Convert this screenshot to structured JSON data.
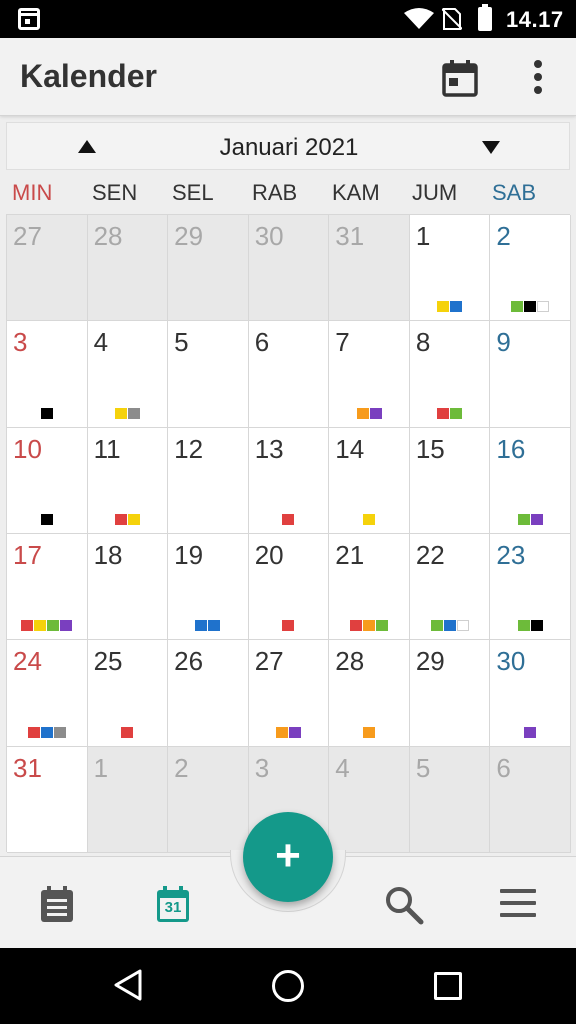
{
  "status_bar": {
    "time": "14.17",
    "icons": [
      "calendar-notification-icon",
      "wifi-icon",
      "no-sim-icon",
      "battery-icon"
    ]
  },
  "app_bar": {
    "title": "Kalender",
    "actions": [
      "today-calendar-icon",
      "overflow-menu-icon"
    ]
  },
  "month_nav": {
    "title": "Januari 2021",
    "prev_icon": "triangle-up-icon",
    "next_icon": "triangle-down-icon"
  },
  "weekdays": [
    "MIN",
    "SEN",
    "SEL",
    "RAB",
    "KAM",
    "JUM",
    "SAB"
  ],
  "colors": {
    "red": "#e0403f",
    "yellow": "#f5d20b",
    "blue": "#1f72cc",
    "gray": "#8c8c8c",
    "green": "#6dbb3a",
    "black": "#000000",
    "white": "#ffffff",
    "orange": "#f79b1c",
    "purple": "#7a3fbf",
    "accent": "#14998a",
    "sunday": "#c94a4a",
    "saturday": "#2f6f96"
  },
  "weeks": [
    [
      {
        "day": "27",
        "other": true,
        "events": []
      },
      {
        "day": "28",
        "other": true,
        "events": []
      },
      {
        "day": "29",
        "other": true,
        "events": []
      },
      {
        "day": "30",
        "other": true,
        "events": []
      },
      {
        "day": "31",
        "other": true,
        "events": []
      },
      {
        "day": "1",
        "other": false,
        "events": [
          "yellow",
          "blue"
        ]
      },
      {
        "day": "2",
        "other": false,
        "events": [
          "green",
          "black",
          "white"
        ]
      }
    ],
    [
      {
        "day": "3",
        "other": false,
        "events": [
          "black"
        ]
      },
      {
        "day": "4",
        "other": false,
        "events": [
          "yellow",
          "gray"
        ]
      },
      {
        "day": "5",
        "other": false,
        "events": []
      },
      {
        "day": "6",
        "other": false,
        "events": []
      },
      {
        "day": "7",
        "other": false,
        "events": [
          "orange",
          "purple"
        ]
      },
      {
        "day": "8",
        "other": false,
        "events": [
          "red",
          "green"
        ]
      },
      {
        "day": "9",
        "other": false,
        "events": []
      }
    ],
    [
      {
        "day": "10",
        "other": false,
        "events": [
          "black"
        ]
      },
      {
        "day": "11",
        "other": false,
        "events": [
          "red",
          "yellow"
        ]
      },
      {
        "day": "12",
        "other": false,
        "events": []
      },
      {
        "day": "13",
        "other": false,
        "events": [
          "red"
        ]
      },
      {
        "day": "14",
        "other": false,
        "events": [
          "yellow"
        ]
      },
      {
        "day": "15",
        "other": false,
        "events": []
      },
      {
        "day": "16",
        "other": false,
        "events": [
          "green",
          "purple"
        ]
      }
    ],
    [
      {
        "day": "17",
        "other": false,
        "events": [
          "red",
          "yellow",
          "green",
          "purple"
        ]
      },
      {
        "day": "18",
        "other": false,
        "events": []
      },
      {
        "day": "19",
        "other": false,
        "events": [
          "blue",
          "blue"
        ]
      },
      {
        "day": "20",
        "other": false,
        "events": [
          "red"
        ]
      },
      {
        "day": "21",
        "other": false,
        "events": [
          "red",
          "orange",
          "green"
        ]
      },
      {
        "day": "22",
        "other": false,
        "events": [
          "green",
          "blue",
          "white"
        ]
      },
      {
        "day": "23",
        "other": false,
        "events": [
          "green",
          "black"
        ]
      }
    ],
    [
      {
        "day": "24",
        "other": false,
        "events": [
          "red",
          "blue",
          "gray"
        ]
      },
      {
        "day": "25",
        "other": false,
        "events": [
          "red"
        ]
      },
      {
        "day": "26",
        "other": false,
        "events": []
      },
      {
        "day": "27",
        "other": false,
        "events": [
          "orange",
          "purple"
        ]
      },
      {
        "day": "28",
        "other": false,
        "events": [
          "orange"
        ]
      },
      {
        "day": "29",
        "other": false,
        "events": []
      },
      {
        "day": "30",
        "other": false,
        "events": [
          "purple"
        ]
      }
    ],
    [
      {
        "day": "31",
        "other": false,
        "events": []
      },
      {
        "day": "1",
        "other": true,
        "events": []
      },
      {
        "day": "2",
        "other": true,
        "events": []
      },
      {
        "day": "3",
        "other": true,
        "events": []
      },
      {
        "day": "4",
        "other": true,
        "events": []
      },
      {
        "day": "5",
        "other": true,
        "events": []
      },
      {
        "day": "6",
        "other": true,
        "events": []
      }
    ]
  ],
  "bottom_nav": {
    "agenda_icon": "agenda-list-icon",
    "month_icon": "calendar-month-icon",
    "month_icon_day": "31",
    "search_icon": "search-icon",
    "menu_icon": "hamburger-menu-icon",
    "fab_label": "+"
  },
  "system_nav": [
    "back-icon",
    "home-icon",
    "recents-icon"
  ]
}
